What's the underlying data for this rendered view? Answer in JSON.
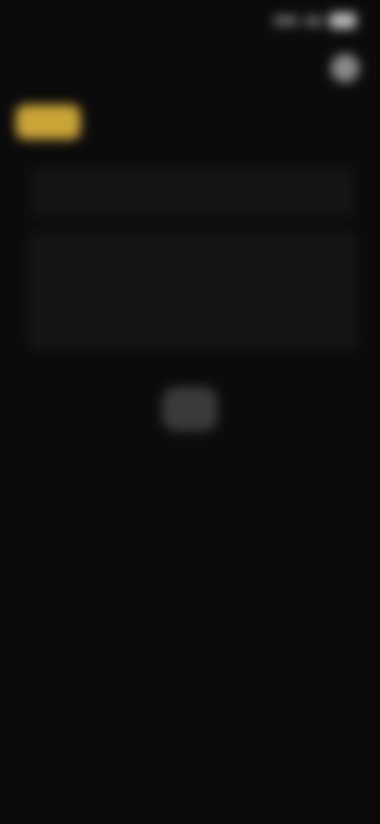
{
  "status_bar": {
    "time": "",
    "signal": "signal-icon",
    "wifi": "wifi-icon",
    "battery": "battery-icon"
  },
  "header": {
    "title": "",
    "action_icon": "profile-icon"
  },
  "filters": [
    {
      "label": "",
      "active": true
    },
    {
      "label": "",
      "active": false
    },
    {
      "label": "",
      "active": false
    },
    {
      "label": "",
      "active": false
    }
  ],
  "search": {
    "placeholder": ""
  },
  "empty_state": {
    "title": "",
    "subtitle": "",
    "subtitle_2": ""
  },
  "colors": {
    "accent": "#c9a437",
    "background": "#0b0b0b",
    "card": "#151515"
  }
}
